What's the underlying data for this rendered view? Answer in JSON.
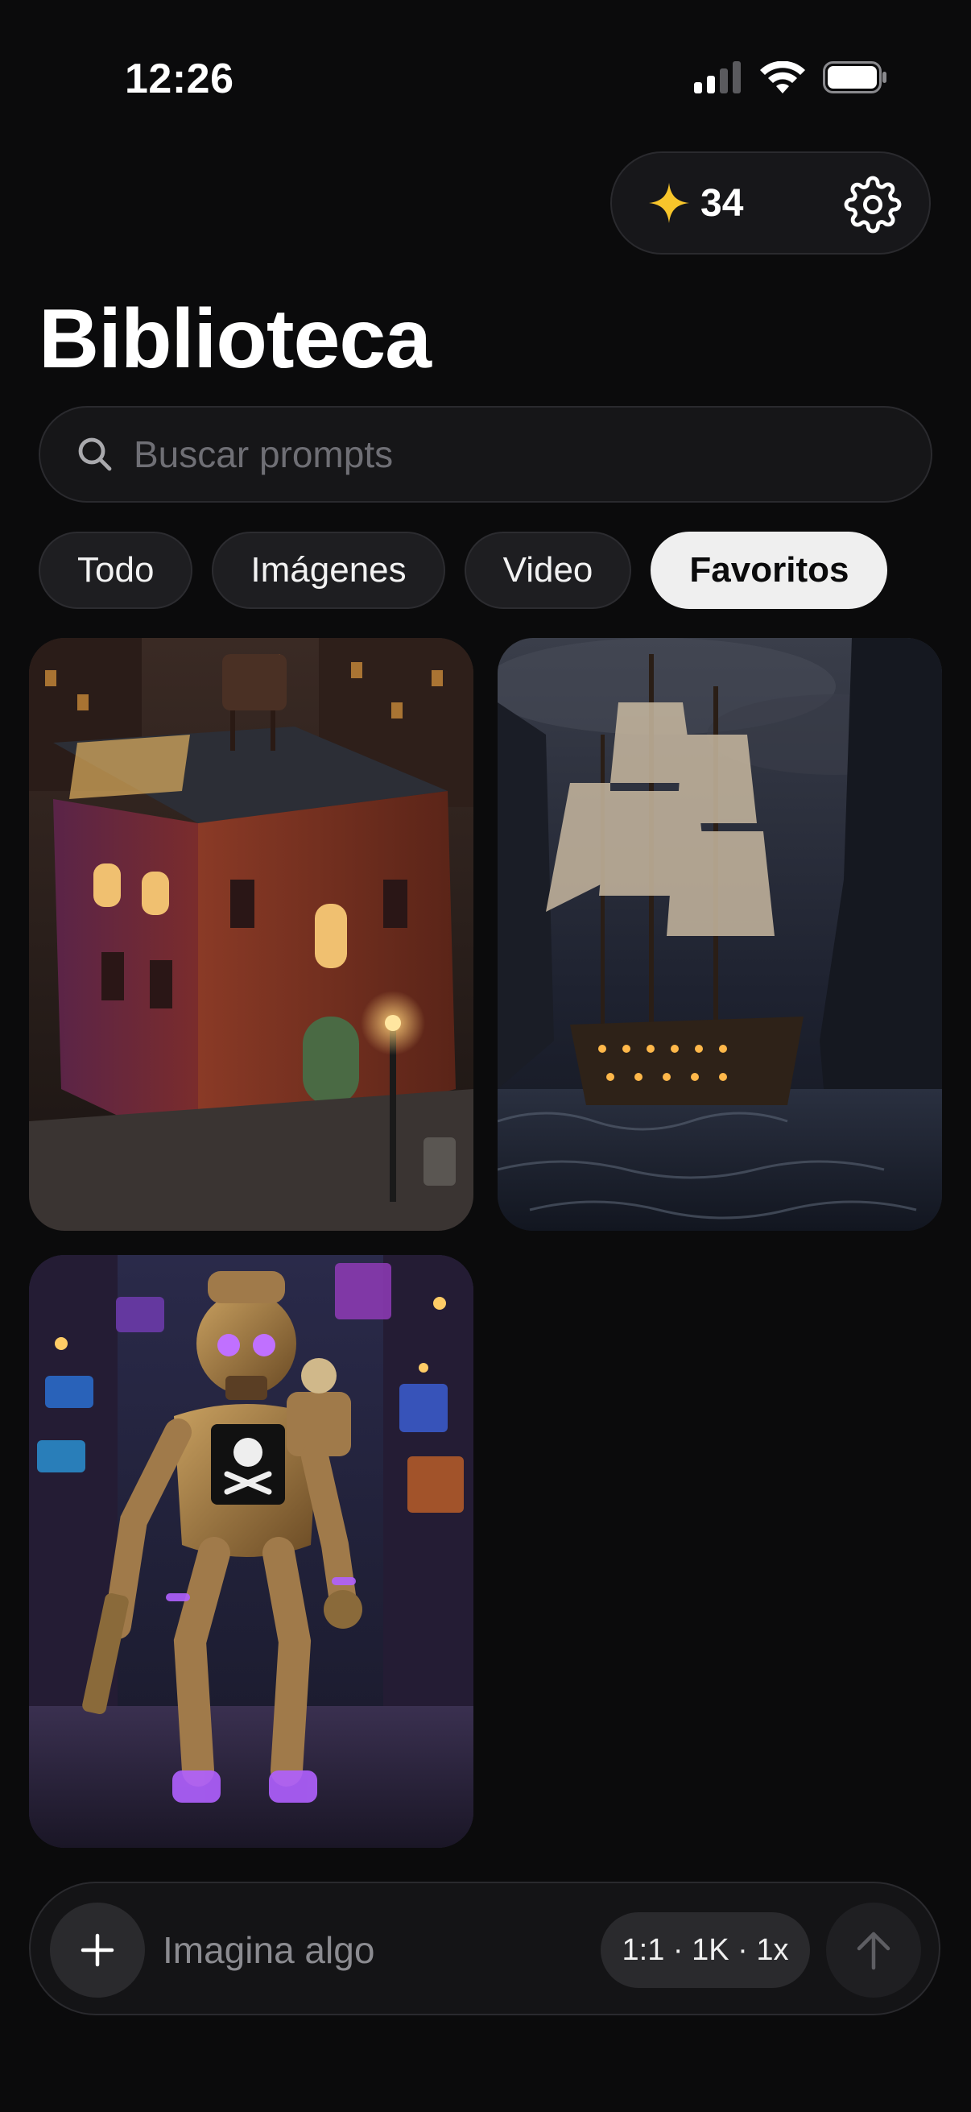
{
  "status": {
    "time": "12:26"
  },
  "credits": {
    "count": "34",
    "icon": "sparkle-icon",
    "accent": "#f7c52b"
  },
  "title": "Biblioteca",
  "search": {
    "placeholder": "Buscar prompts",
    "value": ""
  },
  "filters": [
    {
      "label": "Todo",
      "active": false
    },
    {
      "label": "Imágenes",
      "active": false
    },
    {
      "label": "Video",
      "active": false
    },
    {
      "label": "Favoritos",
      "active": true
    }
  ],
  "gallery": [
    {
      "name": "townhouse-image"
    },
    {
      "name": "pirate-ship-image"
    },
    {
      "name": "pirate-robot-image"
    }
  ],
  "composer": {
    "placeholder": "Imagina algo",
    "settings_label": "1:1 · 1K · 1x"
  }
}
